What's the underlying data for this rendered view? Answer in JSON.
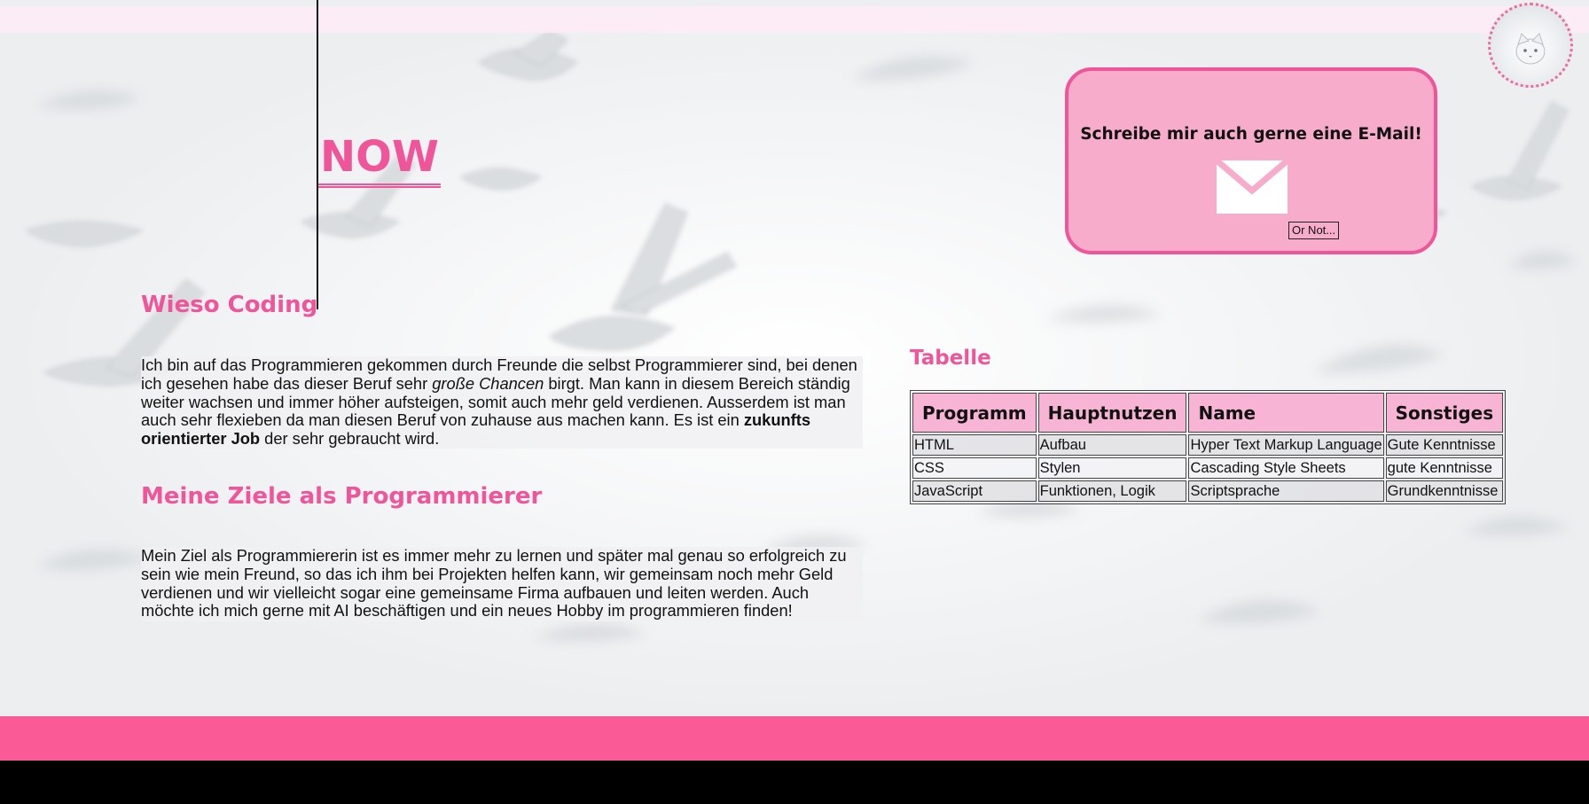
{
  "header": {
    "now_title": "NOW"
  },
  "sections": {
    "wieso": {
      "heading": "Wieso Coding",
      "text_1": "Ich bin auf das Programmieren gekommen durch Freunde die selbst Programmierer sind, bei denen ich gesehen habe das dieser Beruf sehr ",
      "text_em": "große Chancen",
      "text_2": " birgt. Man kann in diesem Bereich ständig weiter wachsen und immer höher aufsteigen, somit auch mehr geld verdienen. Ausserdem ist man auch sehr flexieben da man diesen Beruf von zuhause aus machen kann. Es ist ein ",
      "text_strong": "zukunfts orientierter Job",
      "text_3": " der sehr gebraucht wird."
    },
    "ziele": {
      "heading": "Meine Ziele als Programmierer",
      "text": "Mein Ziel als Programmiererin ist es immer mehr zu lernen und später mal genau so erfolgreich zu sein wie mein Freund, so das ich ihm bei Projekten helfen kann, wir gemeinsam noch mehr Geld verdienen und wir vielleicht sogar eine gemeinsame Firma aufbauen und leiten werden. Auch möchte ich mich gerne mit AI beschäftigen und ein neues Hobby im programmieren finden!"
    }
  },
  "mail": {
    "title": "Schreibe mir auch gerne eine E-Mail!",
    "button_label": "Or Not...",
    "icon": "envelope-icon"
  },
  "table": {
    "heading": "Tabelle",
    "headers": [
      "Programm",
      "Hauptnutzen",
      "Name",
      "Sonstiges"
    ],
    "rows": [
      [
        "HTML",
        "Aufbau",
        "Hyper Text Markup Language",
        "Gute Kenntnisse"
      ],
      [
        "CSS",
        "Stylen",
        "Cascading Style Sheets",
        "gute Kenntnisse"
      ],
      [
        "JavaScript",
        "Funktionen, Logik",
        "Scriptsprache",
        "Grundkenntnisse"
      ]
    ]
  },
  "colors": {
    "accent": "#f0559a",
    "mail_box": "#f8accb",
    "table_header": "#f8b4d5",
    "footer_bar": "#fa5b96",
    "page_bottom": "#000000"
  }
}
